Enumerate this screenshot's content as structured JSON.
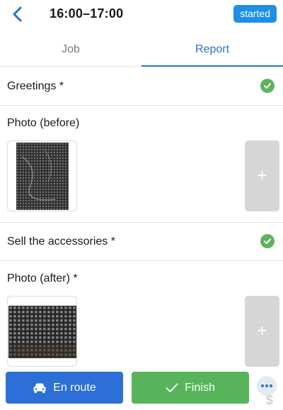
{
  "header": {
    "back_icon": "chevron-left-icon",
    "time_range": "16:00–17:00",
    "status": "started"
  },
  "tabs": [
    {
      "label": "Job",
      "active": false
    },
    {
      "label": "Report",
      "active": true
    }
  ],
  "report": {
    "greetings": {
      "label": "Greetings *",
      "completed": true
    },
    "photo_before": {
      "label": "Photo (before)",
      "photo_count": 1,
      "add_label": "+"
    },
    "sell_accessories": {
      "label": "Sell the accessories *",
      "completed": true
    },
    "photo_after": {
      "label": "Photo (after) *",
      "photo_count": 1,
      "add_label": "+"
    }
  },
  "bottom_bar": {
    "en_route_label": "En route",
    "en_route_icon": "car-icon",
    "finish_label": "Finish",
    "finish_icon": "check-icon",
    "more_icon": "more-dots-icon",
    "dollar_label": "$"
  },
  "colors": {
    "accent_blue": "#2c6fd6",
    "badge_blue": "#1e8fe8",
    "success_green": "#58b45b",
    "divider": "#e2e2e2"
  }
}
